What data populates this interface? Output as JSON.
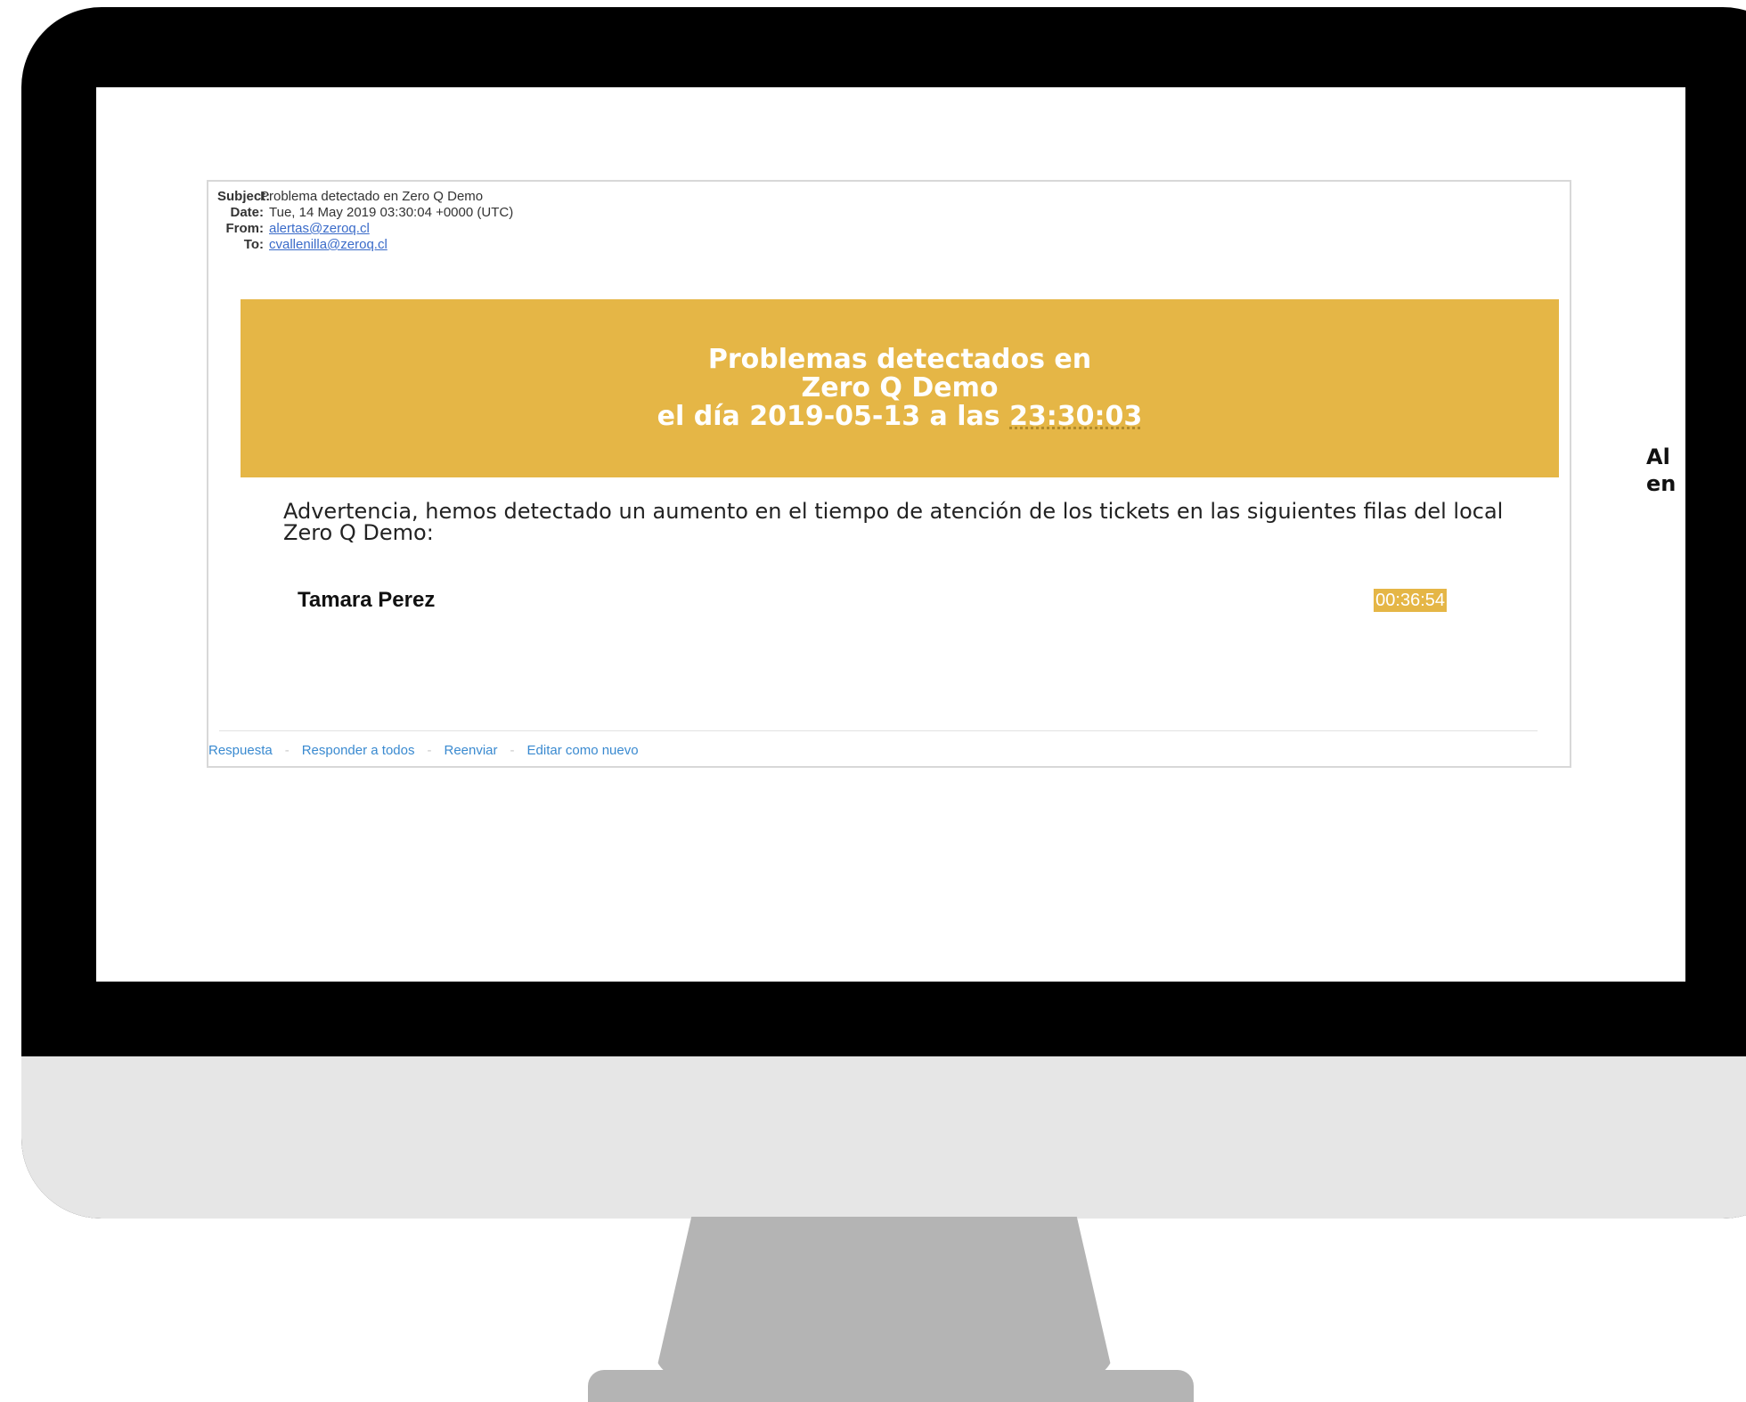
{
  "email": {
    "headers": {
      "subject_label": "Subject:",
      "subject": "Problema detectado en Zero Q Demo",
      "date_label": "Date:",
      "date": "Tue, 14 May 2019 03:30:04 +0000 (UTC)",
      "from_label": "From:",
      "from": "alertas@zeroq.cl",
      "to_label": "To:",
      "to": "cvallenilla@zeroq.cl"
    },
    "banner": {
      "line1": "Problemas detectados en",
      "line2": "Zero Q Demo",
      "line3_prefix": "el día 2019-05-13 a las ",
      "line3_time": "23:30:03"
    },
    "warning_text": "Advertencia, hemos detectado un aumento en el tiempo de atención de los tickets en las siguientes filas del local Zero Q Demo:",
    "lines": [
      {
        "name": "Tamara Perez",
        "time": "00:36:54"
      }
    ],
    "actions": {
      "reply": "Respuesta",
      "reply_all": "Responder a todos",
      "forward": "Reenviar",
      "edit_as_new": "Editar como nuevo",
      "separator": "-"
    }
  },
  "edge_text": "Al\nen",
  "colors": {
    "banner": "#e5b646",
    "link": "#3a6bc9",
    "action_link": "#3a8ad0",
    "monitor_frame": "#000000",
    "monitor_chin": "#e6e6e6",
    "monitor_stand": "#b4b4b4"
  }
}
